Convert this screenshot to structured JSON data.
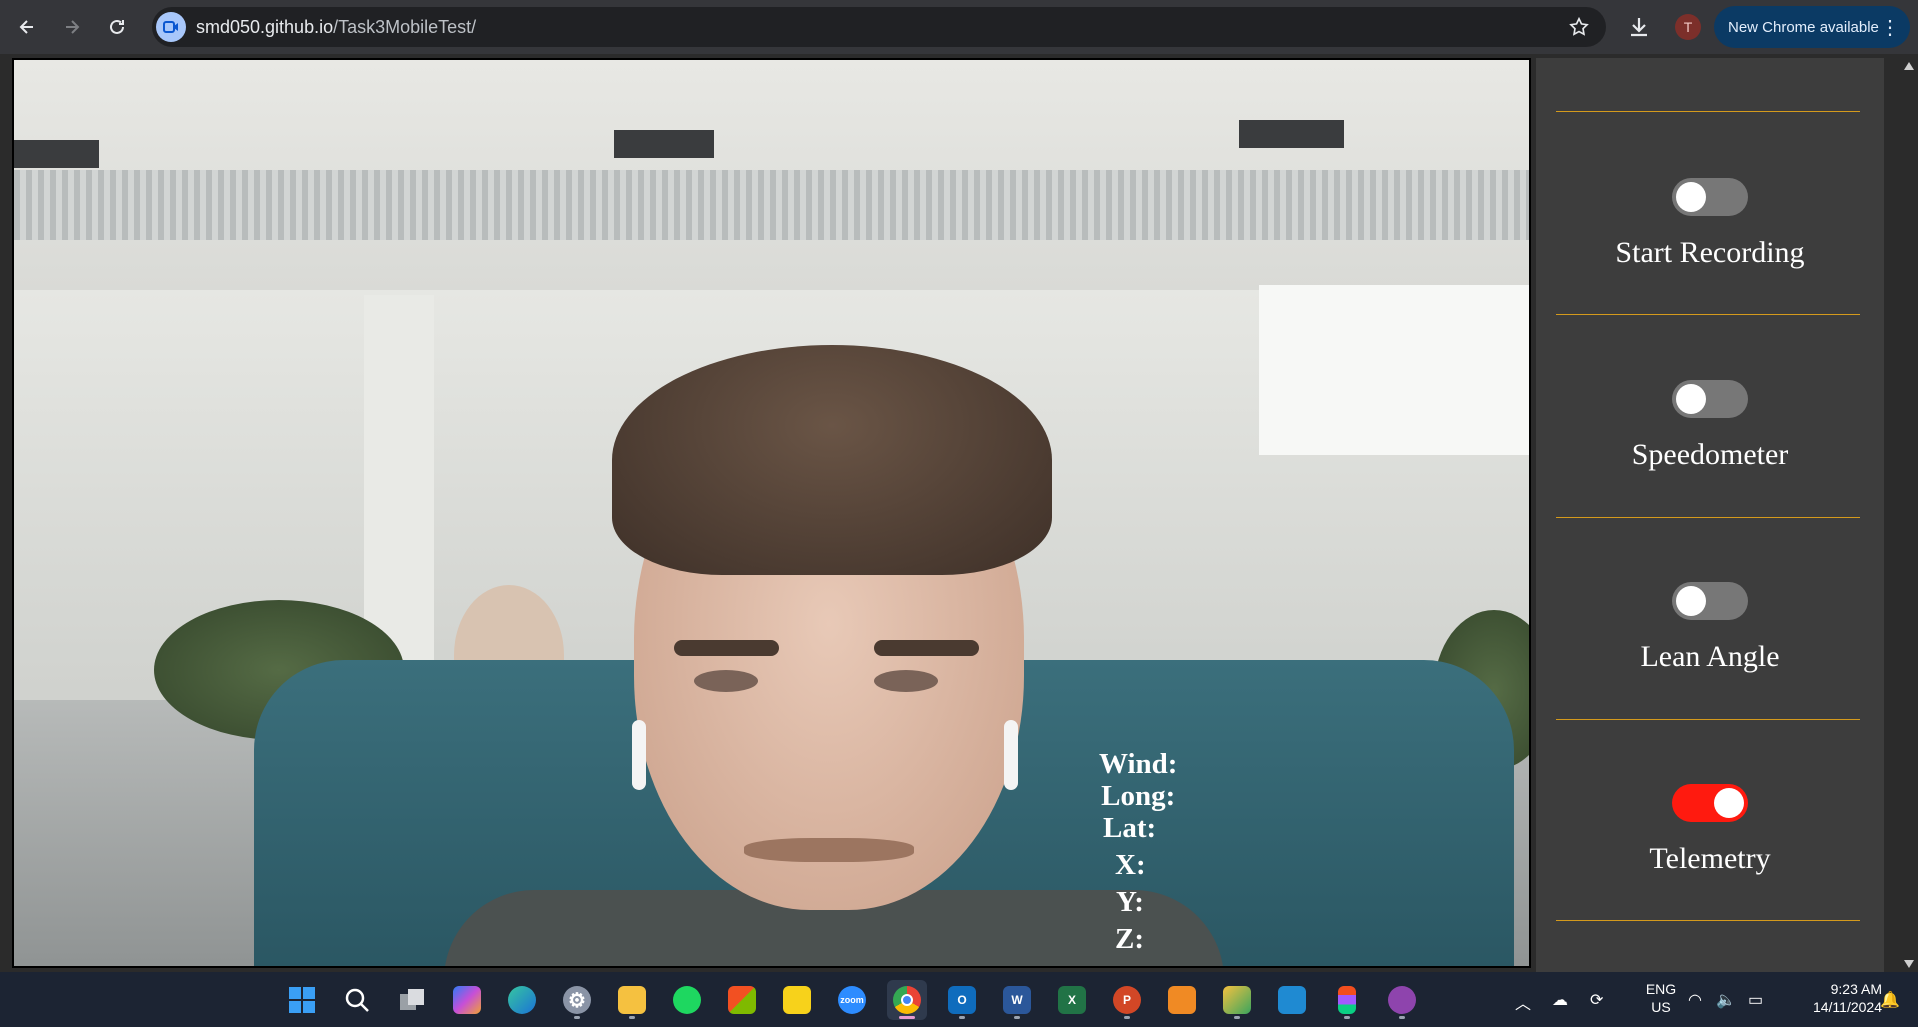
{
  "browser": {
    "url_host": "smd050.github.io",
    "url_path": "/Task3MobileTest/",
    "profile_initial": "T",
    "update_label": "New Chrome available",
    "nav_icons": [
      "back-icon",
      "forward-icon",
      "reload-icon"
    ]
  },
  "telemetry": {
    "wind": "Wind:",
    "long": "Long:",
    "lat": "Lat:",
    "x": "X:",
    "y": "Y:",
    "z": "Z:"
  },
  "controls": [
    {
      "label": "Start Recording",
      "on": false
    },
    {
      "label": "Speedometer",
      "on": false
    },
    {
      "label": "Lean Angle",
      "on": false
    },
    {
      "label": "Telemetry",
      "on": true
    }
  ],
  "colors": {
    "divider": "#d49a1c",
    "toggle_on": "#ff1a0f",
    "toggle_off": "#777777",
    "panel_bg": "#3d3d3d"
  },
  "taskbar": {
    "apps": [
      "windows-start",
      "search",
      "task-view",
      "copilot",
      "edge",
      "settings",
      "file-explorer",
      "spotify",
      "microsoft-store",
      "sticky-notes",
      "zoom",
      "chrome",
      "outlook",
      "word",
      "excel",
      "powerpoint",
      "app-icon",
      "snipping-tool",
      "vscode",
      "figma",
      "github-desktop"
    ],
    "zoom_label": "zoom",
    "language_line1": "ENG",
    "language_line2": "US",
    "time": "9:23 AM",
    "date": "14/11/2024"
  }
}
